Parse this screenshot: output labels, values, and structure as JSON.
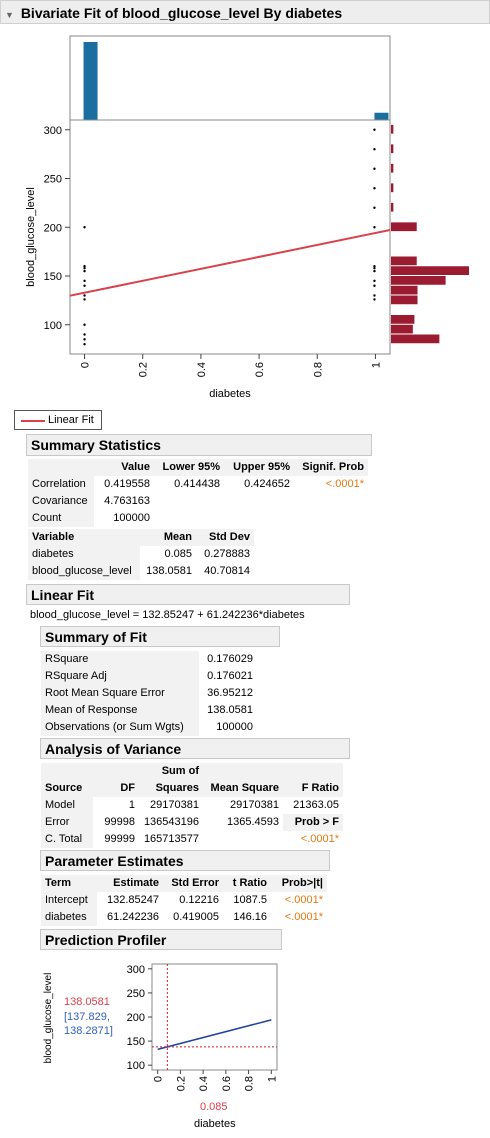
{
  "window": {
    "title": "Bivariate Fit of blood_glucose_level By diabetes"
  },
  "chart_data": [
    {
      "type": "scatter",
      "title": "",
      "xlabel": "diabetes",
      "ylabel": "blood_glucose_level",
      "xlim": [
        -0.05,
        1.05
      ],
      "ylim": [
        70,
        310
      ],
      "x_ticks": [
        "0",
        "0.2",
        "0.4",
        "0.6",
        "0.8",
        "1"
      ],
      "y_ticks": [
        "100",
        "150",
        "200",
        "250",
        "300"
      ],
      "points_x0": [
        80,
        85,
        90,
        100,
        126,
        130,
        140,
        145,
        155,
        158,
        160,
        200
      ],
      "points_x1": [
        126,
        130,
        140,
        145,
        155,
        158,
        160,
        200,
        220,
        240,
        260,
        280,
        300
      ],
      "fit_line": {
        "intercept": 132.85247,
        "slope": 61.242236,
        "color": "#d9414b"
      },
      "top_histogram": {
        "categories": [
          0,
          1
        ],
        "heights": [
          1.0,
          0.093
        ],
        "color": "#1a6ea0"
      },
      "right_histogram": {
        "bins": [
          [
            80,
            90,
            0.62
          ],
          [
            90,
            100,
            0.28
          ],
          [
            100,
            110,
            0.3
          ],
          [
            120,
            130,
            0.34
          ],
          [
            130,
            140,
            0.34
          ],
          [
            140,
            150,
            0.7
          ],
          [
            150,
            160,
            1.0
          ],
          [
            160,
            170,
            0.33
          ],
          [
            195,
            205,
            0.33
          ],
          [
            215,
            225,
            0.03
          ],
          [
            235,
            245,
            0.03
          ],
          [
            255,
            265,
            0.03
          ],
          [
            275,
            285,
            0.03
          ],
          [
            295,
            305,
            0.03
          ]
        ],
        "color": "#9b1b30"
      },
      "grid": false
    },
    {
      "type": "line",
      "title": "Prediction Profiler",
      "xlabel": "diabetes",
      "ylabel": "blood_glucose_level",
      "xlim": [
        -0.05,
        1.05
      ],
      "ylim": [
        90,
        310
      ],
      "x_ticks": [
        "0",
        "0.2",
        "0.4",
        "0.6",
        "0.8",
        "1"
      ],
      "y_ticks": [
        "100",
        "150",
        "200",
        "250",
        "300"
      ],
      "series": [
        {
          "x": [
            0,
            1
          ],
          "y": [
            132.85247,
            194.094706
          ],
          "color": "#2040a0"
        }
      ],
      "current_x": 0.085,
      "current_y": 138.0581
    }
  ],
  "legend": {
    "label": "Linear Fit"
  },
  "summary_statistics": {
    "title": "Summary Statistics",
    "headers": [
      "",
      "Value",
      "Lower 95%",
      "Upper 95%",
      "Signif. Prob"
    ],
    "rows": [
      [
        "Correlation",
        "0.419558",
        "0.414438",
        "0.424652",
        "<.0001*"
      ],
      [
        "Covariance",
        "4.763163",
        "",
        "",
        ""
      ],
      [
        "Count",
        "100000",
        "",
        "",
        ""
      ]
    ],
    "var_headers": [
      "Variable",
      "Mean",
      "Std Dev"
    ],
    "var_rows": [
      [
        "diabetes",
        "0.085",
        "0.278883"
      ],
      [
        "blood_glucose_level",
        "138.0581",
        "40.70814"
      ]
    ]
  },
  "linear_fit": {
    "title": "Linear Fit",
    "equation": "blood_glucose_level = 132.85247 + 61.242236*diabetes"
  },
  "summary_of_fit": {
    "title": "Summary of Fit",
    "rows": [
      [
        "RSquare",
        "0.176029"
      ],
      [
        "RSquare Adj",
        "0.176021"
      ],
      [
        "Root Mean Square Error",
        "36.95212"
      ],
      [
        "Mean of Response",
        "138.0581"
      ],
      [
        "Observations (or Sum Wgts)",
        "100000"
      ]
    ]
  },
  "anova": {
    "title": "Analysis of Variance",
    "header_top": "Sum of",
    "headers": [
      "Source",
      "DF",
      "Squares",
      "Mean Square",
      "F Ratio"
    ],
    "rows": [
      [
        "Model",
        "1",
        "29170381",
        "29170381",
        "21363.05"
      ],
      [
        "Error",
        "99998",
        "136543196",
        "1365.4593",
        "Prob > F"
      ],
      [
        "C. Total",
        "99999",
        "165713577",
        "",
        "<.0001*"
      ]
    ]
  },
  "parameter_estimates": {
    "title": "Parameter Estimates",
    "headers": [
      "Term",
      "Estimate",
      "Std Error",
      "t Ratio",
      "Prob>|t|"
    ],
    "rows": [
      [
        "Intercept",
        "132.85247",
        "0.12216",
        "1087.5",
        "<.0001*"
      ],
      [
        "diabetes",
        "61.242236",
        "0.419005",
        "146.16",
        "<.0001*"
      ]
    ]
  },
  "profiler": {
    "title": "Prediction Profiler",
    "y_value": "138.0581",
    "ci_line1": "[137.829,",
    "ci_line2": "138.2871]",
    "x_value": "0.085",
    "xlabel": "diabetes",
    "ylabel": "blood_glucose_level"
  }
}
